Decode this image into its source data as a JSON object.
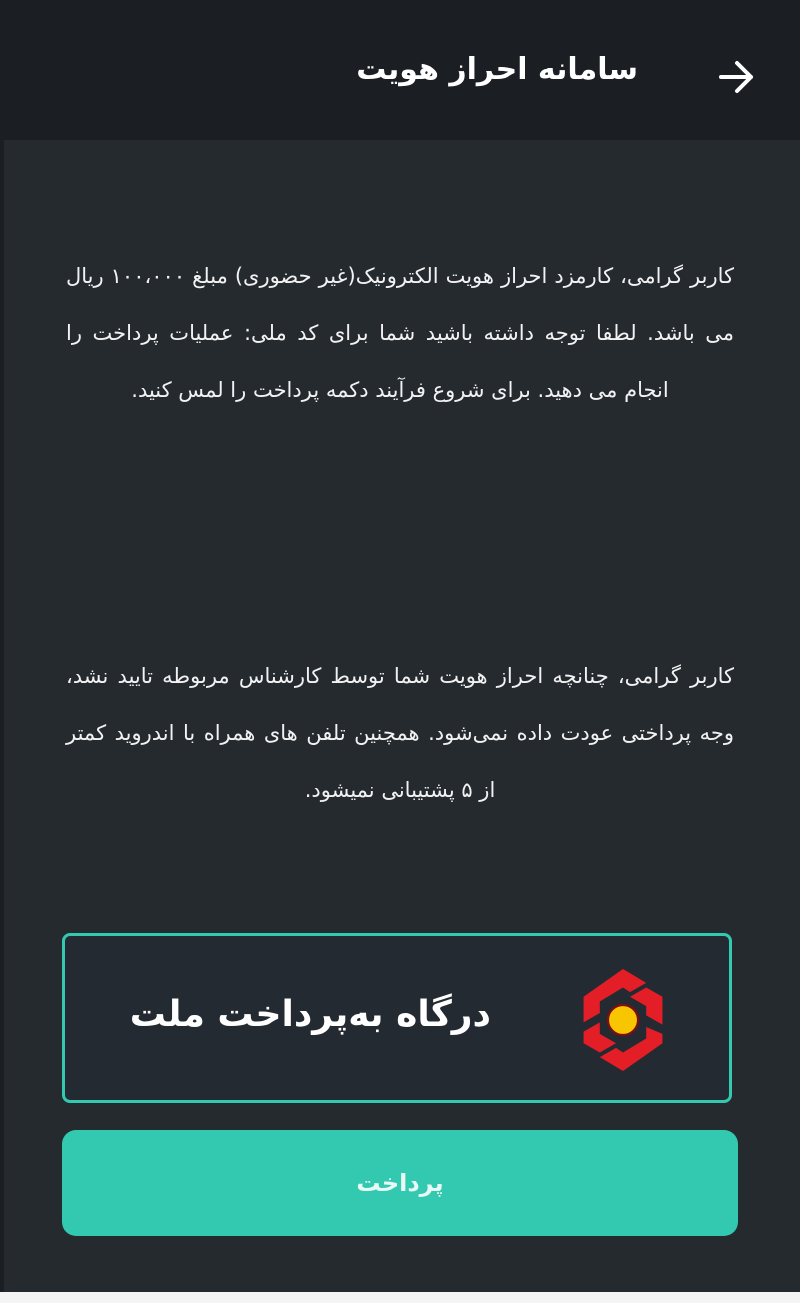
{
  "header": {
    "title": "سامانه احراز هویت",
    "back_icon": "arrow-right-icon"
  },
  "notice": {
    "paragraph1": "کاربر گرامی، کارمزد احراز هویت الکترونیک(غیر حضوری) مبلغ ۱۰۰،۰۰۰ ریال می باشد. لطفا توجه داشته باشید شما برای کد ملی:                  عملیات پرداخت را انجام می دهید. برای شروع فرآیند دکمه پرداخت را لمس کنید.",
    "paragraph2": "کاربر گرامی، چنانچه احراز هویت شما توسط کارشناس مربوطه تایید نشد، وجه پرداختی عودت داده نمی‌شود. همچنین تلفن های همراه با اندروید کمتر از ۵ پشتیبانی نمیشود."
  },
  "gateway": {
    "label": "درگاه به‌پرداخت ملت",
    "logo_icon": "mellat-bank-logo-icon"
  },
  "pay_button": {
    "label": "پرداخت"
  },
  "colors": {
    "header_bg": "#1b1f24",
    "page_bg": "#252a2f",
    "accent": "#32c9b0",
    "logo_red": "#e41e26",
    "logo_yellow": "#f7c600"
  }
}
